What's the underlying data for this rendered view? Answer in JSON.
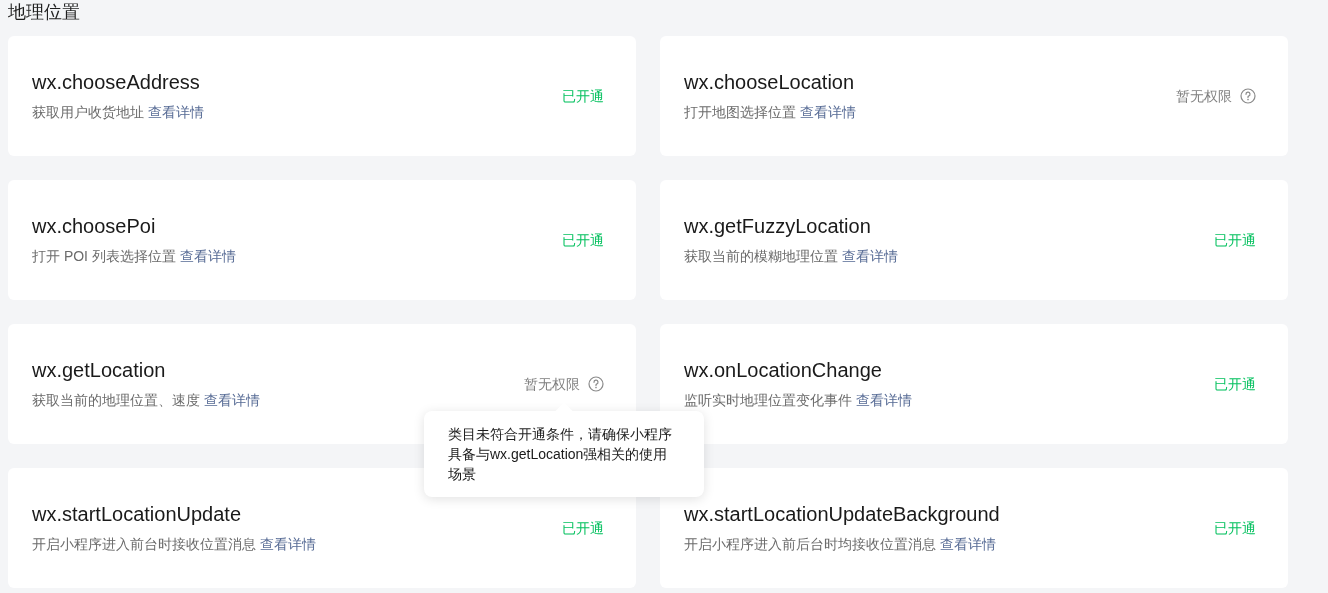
{
  "section_title": "地理位置",
  "apis": [
    {
      "name": "wx.chooseAddress",
      "description": "获取用户收货地址",
      "link": "查看详情",
      "status": "已开通",
      "kind": "enabled"
    },
    {
      "name": "wx.chooseLocation",
      "description": "打开地图选择位置",
      "link": "查看详情",
      "status": "暂无权限",
      "kind": "restricted"
    },
    {
      "name": "wx.choosePoi",
      "description": "打开 POI 列表选择位置",
      "link": "查看详情",
      "status": "已开通",
      "kind": "enabled"
    },
    {
      "name": "wx.getFuzzyLocation",
      "description": "获取当前的模糊地理位置",
      "link": "查看详情",
      "status": "已开通",
      "kind": "enabled"
    },
    {
      "name": "wx.getLocation",
      "description": "获取当前的地理位置、速度",
      "link": "查看详情",
      "status": "暂无权限",
      "kind": "restricted",
      "tooltip": "类目未符合开通条件，请确保小程序具备与wx.getLocation强相关的使用场景"
    },
    {
      "name": "wx.onLocationChange",
      "description": "监听实时地理位置变化事件",
      "link": "查看详情",
      "status": "已开通",
      "kind": "enabled"
    },
    {
      "name": "wx.startLocationUpdate",
      "description": "开启小程序进入前台时接收位置消息",
      "link": "查看详情",
      "status": "已开通",
      "kind": "enabled"
    },
    {
      "name": "wx.startLocationUpdateBackground",
      "description": "开启小程序进入前后台时均接收位置消息",
      "link": "查看详情",
      "status": "已开通",
      "kind": "enabled"
    }
  ]
}
